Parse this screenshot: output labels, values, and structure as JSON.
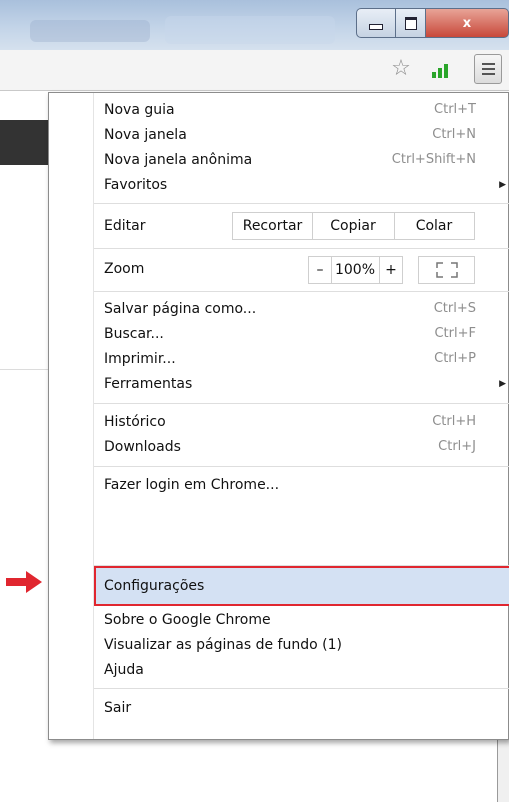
{
  "window": {
    "minimize": "minimize",
    "maximize": "maximize",
    "close": "x"
  },
  "toolbar": {
    "star_icon": "star-icon",
    "signal_icon": "signal-icon",
    "menu_icon": "hamburger-menu-icon"
  },
  "menu": {
    "items": [
      {
        "label": "Nova guia",
        "shortcut": "Ctrl+T"
      },
      {
        "label": "Nova janela",
        "shortcut": "Ctrl+N"
      },
      {
        "label": "Nova janela anônima",
        "shortcut": "Ctrl+Shift+N"
      },
      {
        "label": "Favoritos",
        "shortcut": ""
      },
      {
        "label": "Editar"
      },
      {
        "label": "Zoom"
      },
      {
        "label": "Salvar página como...",
        "shortcut": "Ctrl+S"
      },
      {
        "label": "Buscar...",
        "shortcut": "Ctrl+F"
      },
      {
        "label": "Imprimir...",
        "shortcut": "Ctrl+P"
      },
      {
        "label": "Ferramentas",
        "shortcut": ""
      },
      {
        "label": "Histórico",
        "shortcut": "Ctrl+H"
      },
      {
        "label": "Downloads",
        "shortcut": "Ctrl+J"
      },
      {
        "label": "Fazer login em Chrome..."
      },
      {
        "label": "Configurações"
      },
      {
        "label": "Sobre o Google Chrome"
      },
      {
        "label": "Visualizar as páginas de fundo (1)"
      },
      {
        "label": "Ajuda"
      },
      {
        "label": "Sair"
      }
    ],
    "edit": {
      "cut": "Recortar",
      "copy": "Copiar",
      "paste": "Colar"
    },
    "zoom": {
      "minus": "–",
      "value": "100%",
      "plus": "+"
    }
  },
  "colors": {
    "highlight": "#d4e1f3",
    "highlight_border": "#e0262f",
    "arrow": "#e0262f"
  }
}
